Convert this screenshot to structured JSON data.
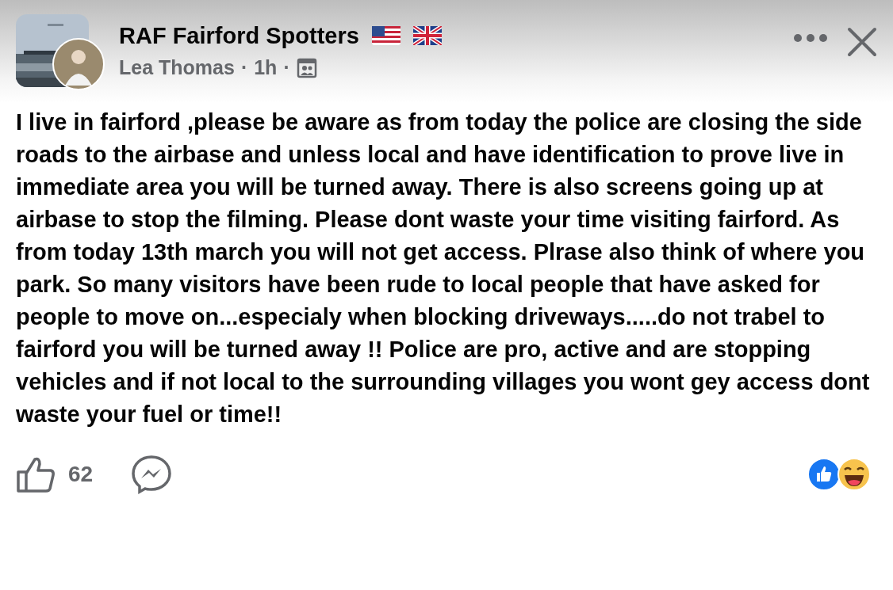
{
  "post": {
    "group_name": "RAF Fairford Spotters",
    "author": "Lea Thomas",
    "separator_1": "·",
    "time": "1h",
    "separator_2": "·",
    "body": "I live in fairford ,please be aware as from today the police are closing the side roads to the airbase and unless local and have identification to prove live in immediate area you will be turned away. There is also screens going up at airbase to stop the filming. Please dont waste your time visiting fairford. As from today 13th march you will not get access. Plrase also think of where you park. So many visitors have been rude to local people that have asked for people to move on...especialy when blocking driveways.....do not trabel to fairford you will be turned away !! Police are pro, active and are stopping vehicles and if not local to the surrounding villages you wont gey access dont waste your fuel or time!!",
    "like_count": "62"
  }
}
